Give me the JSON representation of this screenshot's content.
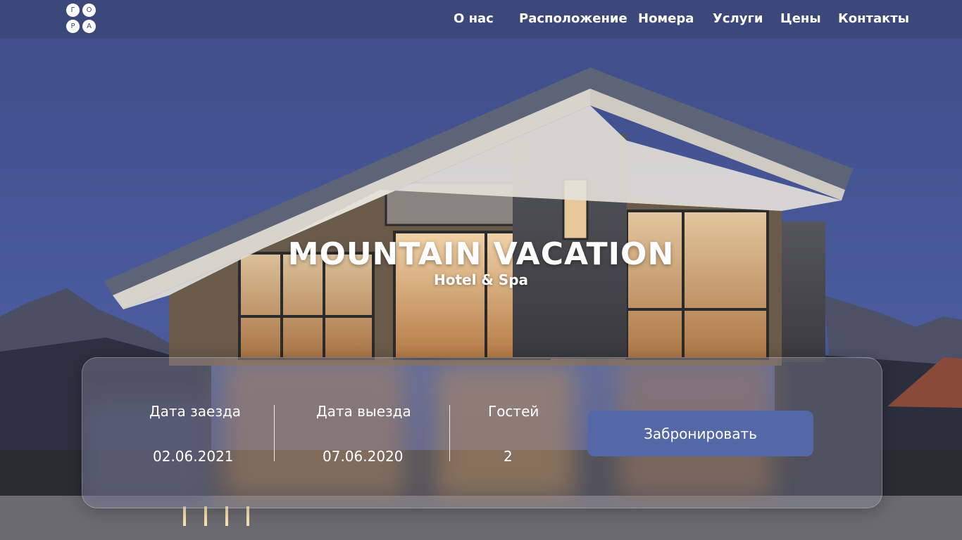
{
  "logo": {
    "letters": [
      "Г",
      "О",
      "Р",
      "А"
    ]
  },
  "nav": {
    "items": [
      {
        "label": "О нас"
      },
      {
        "label": "Расположение"
      },
      {
        "label": "Номера"
      },
      {
        "label": "Услуги"
      },
      {
        "label": "Цены"
      },
      {
        "label": "Контакты"
      }
    ]
  },
  "hero": {
    "title": "MOUNTAIN VACATION",
    "subtitle": "Hotel & Spa"
  },
  "booking": {
    "checkin": {
      "label": "Дата заезда",
      "value": "02.06.2021"
    },
    "checkout": {
      "label": "Дата выезда",
      "value": "07.06.2020"
    },
    "guests": {
      "label": "Гостей",
      "value": "2"
    },
    "button_label": "Забронировать"
  },
  "colors": {
    "sky": "#45569a",
    "navbar": "#3c4878",
    "button": "#5468a8",
    "text": "#ffffff"
  }
}
